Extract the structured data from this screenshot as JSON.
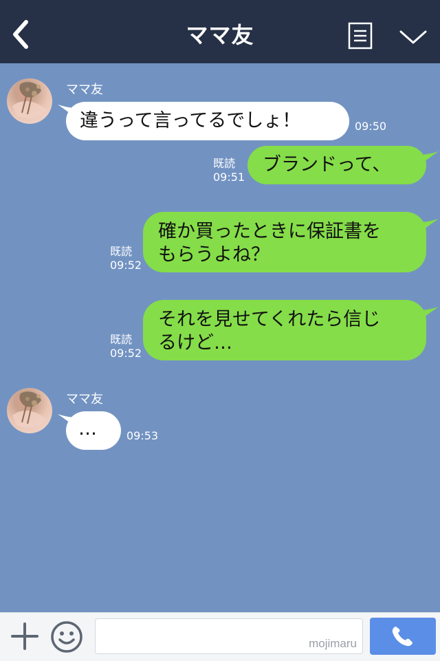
{
  "header": {
    "title": "ママ友",
    "back_icon": "chevron-left-icon",
    "menu_icon": "note-menu-icon",
    "collapse_icon": "chevron-down-icon"
  },
  "messages": [
    {
      "side": "left",
      "sender": "ママ友",
      "text": [
        "違うって言ってるでしょ！"
      ],
      "time": "09:50"
    },
    {
      "side": "right",
      "read": "既読",
      "time": "09:51",
      "text": [
        "ブランドって、"
      ]
    },
    {
      "side": "right",
      "read": "既読",
      "time": "09:52",
      "text": [
        "確か買ったときに保証書を",
        "もらうよね？"
      ]
    },
    {
      "side": "right",
      "read": "既読",
      "time": "09:52",
      "text": [
        "それを見せてくれたら信じ",
        "るけど…"
      ]
    },
    {
      "side": "left",
      "sender": "ママ友",
      "text": [
        "…"
      ],
      "time": "09:53"
    }
  ],
  "input": {
    "placeholder": "",
    "watermark": "mojimaru",
    "plus_icon": "plus-icon",
    "emoji_icon": "smiley-icon",
    "call_icon": "phone-icon"
  },
  "colors": {
    "header_bg": "#263046",
    "chat_bg": "#7293c2",
    "my_bubble": "#85dd49",
    "their_bubble": "#ffffff",
    "call_button": "#5b8ee6"
  }
}
